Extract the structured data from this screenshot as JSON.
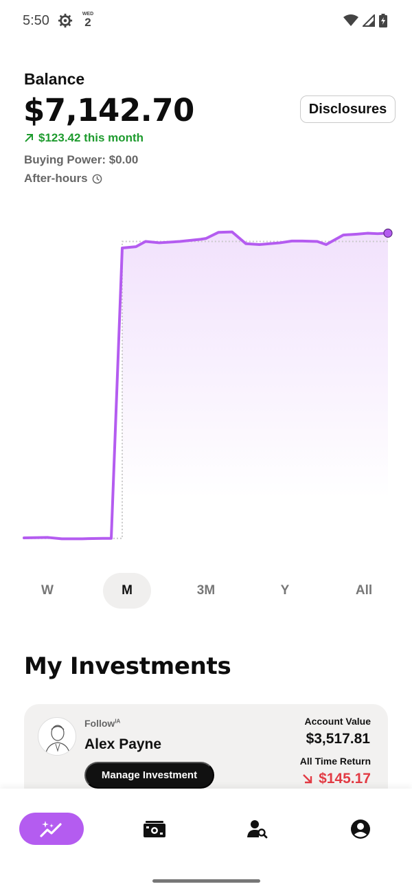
{
  "status_bar": {
    "time": "5:50",
    "calendar_day": "WED",
    "calendar_date": "2",
    "icons": [
      "gear-icon",
      "calendar-icon",
      "wifi-icon",
      "signal-icon",
      "battery-charging-icon"
    ]
  },
  "header": {
    "balance_label": "Balance",
    "balance_value": "$7,142.70",
    "change_text": "$123.42 this month",
    "change_direction": "up",
    "buying_power": "Buying Power: $0.00",
    "after_hours": "After-hours",
    "disclosures_label": "Disclosures"
  },
  "colors": {
    "accent": "#b45cf0",
    "positive": "#1e9b2e",
    "negative": "#e23b44"
  },
  "chart_data": {
    "type": "line",
    "series": [
      {
        "values": [
          110,
          120,
          90,
          90,
          100,
          100,
          6800,
          6830,
          6950,
          6920,
          6950,
          7000,
          7020,
          7160,
          7170,
          6900,
          6880,
          6920,
          6960,
          6960,
          6950,
          6880,
          7100,
          7120,
          7140,
          7130,
          7142.7
        ]
      }
    ],
    "baseline": [
      100,
      6950
    ],
    "baseline_style": "dotted",
    "fill": "gradient",
    "end_marker": true,
    "grid": false,
    "legend": "none"
  },
  "range_tabs": [
    {
      "label": "W",
      "active": false
    },
    {
      "label": "M",
      "active": true
    },
    {
      "label": "3M",
      "active": false
    },
    {
      "label": "Y",
      "active": false
    },
    {
      "label": "All",
      "active": false
    }
  ],
  "investments": {
    "title": "My Investments",
    "card": {
      "follow_label": "Follow",
      "follow_superscript": "IA",
      "name": "Alex Payne",
      "manage_label": "Manage Investment",
      "account_value_label": "Account Value",
      "account_value": "$3,517.81",
      "return_label": "All Time Return",
      "return_value": "$145.17",
      "return_direction": "down"
    }
  },
  "bottom_nav": [
    {
      "icon": "sparkle-chart-icon",
      "active": true
    },
    {
      "icon": "cash-icon",
      "active": false
    },
    {
      "icon": "person-search-icon",
      "active": false
    },
    {
      "icon": "account-circle-icon",
      "active": false
    }
  ]
}
